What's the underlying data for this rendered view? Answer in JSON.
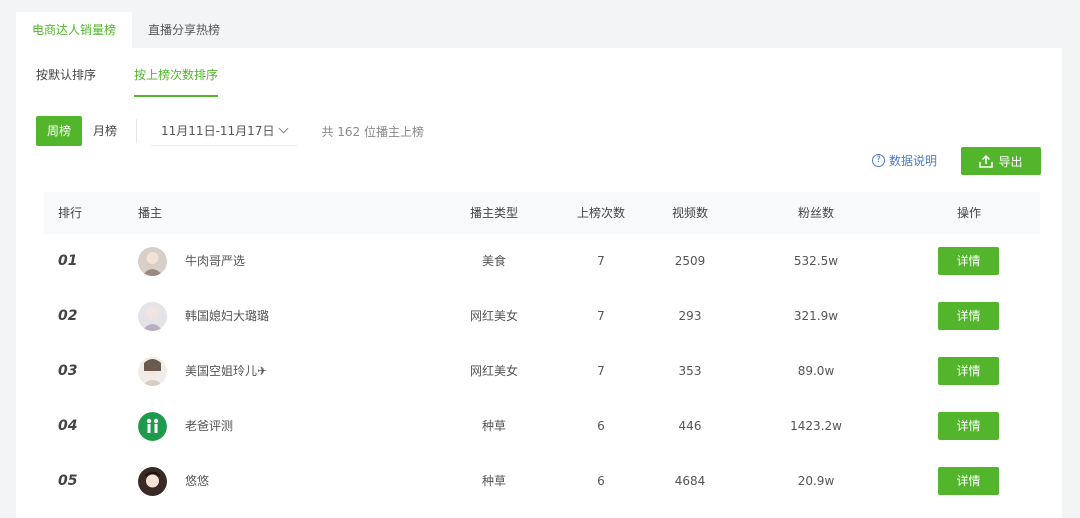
{
  "top_tabs": [
    {
      "label": "电商达人销量榜",
      "active": true
    },
    {
      "label": "直播分享热榜",
      "active": false
    }
  ],
  "sort_tabs": [
    {
      "label": "按默认排序",
      "active": false
    },
    {
      "label": "按上榜次数排序",
      "active": true
    }
  ],
  "period": {
    "week": "周榜",
    "month": "月榜",
    "selected": "周榜"
  },
  "date_range": "11月11日-11月17日",
  "count_text": "共 162 位播主上榜",
  "help_label": "数据说明",
  "export_label": "导出",
  "table": {
    "headers": {
      "rank": "排行",
      "host": "播主",
      "type": "播主类型",
      "times": "上榜次数",
      "videos": "视频数",
      "fans": "粉丝数",
      "action": "操作"
    },
    "rows": [
      {
        "rank": "01",
        "name": "牛肉哥严选",
        "type": "美食",
        "times": "7",
        "videos": "2509",
        "fans": "532.5w",
        "action": "详情"
      },
      {
        "rank": "02",
        "name": "韩国媳妇大璐璐",
        "type": "网红美女",
        "times": "7",
        "videos": "293",
        "fans": "321.9w",
        "action": "详情"
      },
      {
        "rank": "03",
        "name": "美国空姐玲儿✈",
        "type": "网红美女",
        "times": "7",
        "videos": "353",
        "fans": "89.0w",
        "action": "详情"
      },
      {
        "rank": "04",
        "name": "老爸评测",
        "type": "种草",
        "times": "6",
        "videos": "446",
        "fans": "1423.2w",
        "action": "详情"
      },
      {
        "rank": "05",
        "name": "悠悠",
        "type": "种草",
        "times": "6",
        "videos": "4684",
        "fans": "20.9w",
        "action": "详情"
      }
    ]
  },
  "colors": {
    "accent": "#52b52b",
    "link": "#4a7bd3"
  }
}
